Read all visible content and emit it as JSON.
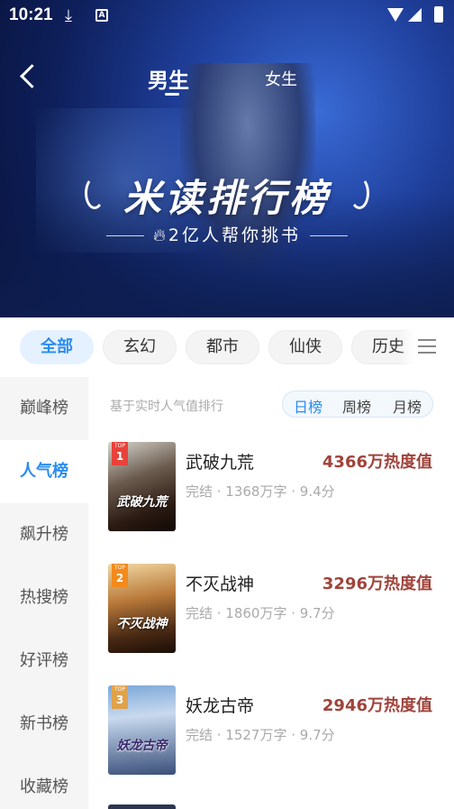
{
  "status_bar": {
    "time": "10:21",
    "notif_icon_letter": "A"
  },
  "header": {
    "tab_male": "男生",
    "tab_female": "女生",
    "active_tab": "男生"
  },
  "banner": {
    "title": "米读排行榜",
    "subtitle": "2亿人帮你挑书"
  },
  "categories": [
    {
      "label": "全部",
      "active": true
    },
    {
      "label": "玄幻",
      "active": false
    },
    {
      "label": "都市",
      "active": false
    },
    {
      "label": "仙侠",
      "active": false
    },
    {
      "label": "历史",
      "active": false
    }
  ],
  "sidebar": {
    "items": [
      {
        "label": "巅峰榜",
        "active": false
      },
      {
        "label": "人气榜",
        "active": true
      },
      {
        "label": "飙升榜",
        "active": false
      },
      {
        "label": "热搜榜",
        "active": false
      },
      {
        "label": "好评榜",
        "active": false
      },
      {
        "label": "新书榜",
        "active": false
      },
      {
        "label": "收藏榜",
        "active": false
      }
    ]
  },
  "ranking": {
    "hint": "基于实时人气值排行",
    "periods": [
      {
        "label": "日榜",
        "active": true
      },
      {
        "label": "周榜",
        "active": false
      },
      {
        "label": "月榜",
        "active": false
      }
    ],
    "books": [
      {
        "rank": "1",
        "badge_top": "TOP",
        "title": "武破九荒",
        "heat": "4366万热度值",
        "meta": "完结 · 1368万字 · 9.4分",
        "cover_title": "武破九荒",
        "badge_color": "#e8423a"
      },
      {
        "rank": "2",
        "badge_top": "TOP",
        "title": "不灭战神",
        "heat": "3296万热度值",
        "meta": "完结 · 1860万字 · 9.7分",
        "cover_title": "不灭战神",
        "badge_color": "#f28a1c"
      },
      {
        "rank": "3",
        "badge_top": "TOP",
        "title": "妖龙古帝",
        "heat": "2946万热度值",
        "meta": "完结 · 1527万字 · 9.7分",
        "cover_title": "妖龙古帝",
        "badge_color": "#e0a24a"
      }
    ]
  },
  "colors": {
    "accent": "#2a8cf0",
    "heat": "#a0433b",
    "hero_bg": "#1f3f9b"
  }
}
